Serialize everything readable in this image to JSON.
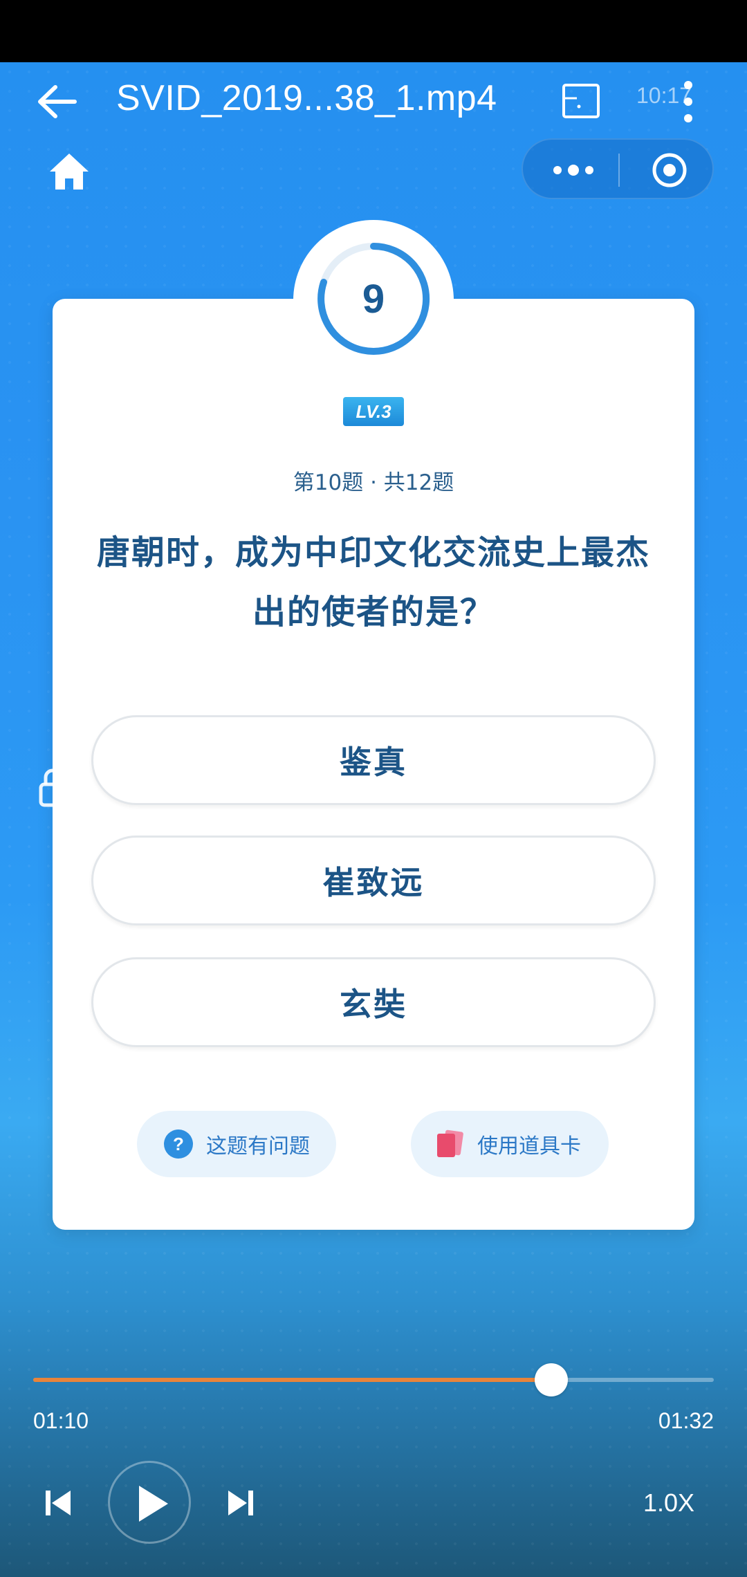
{
  "player": {
    "title": "SVID_2019...38_1.mp4",
    "status_ghost": "10:17",
    "time_current": "01:10",
    "time_total": "01:32",
    "progress_fraction": 0.761,
    "speed": "1.0X"
  },
  "quiz": {
    "timer_value": "9",
    "level": "LV.3",
    "counter": "第10题 · 共12题",
    "question": "唐朝时，成为中印文化交流史上最杰出的使者的是？",
    "options": [
      "鉴真",
      "崔致远",
      "玄奘"
    ],
    "report_label": "这题有问题",
    "prop_card_label": "使用道具卡"
  },
  "colors": {
    "accent_blue": "#1c5486",
    "progress_orange": "#e8843b",
    "background_blue": "#2a93f2"
  },
  "icons": {
    "back": "arrow-left-icon",
    "cast": "cast-icon",
    "more": "more-vertical-icon",
    "home": "home-icon",
    "capsule_more": "more-horizontal-icon",
    "capsule_close": "target-icon",
    "report": "question-circle-icon",
    "prop_card": "cards-icon",
    "prev": "skip-previous-icon",
    "play": "play-icon",
    "next": "skip-next-icon"
  }
}
